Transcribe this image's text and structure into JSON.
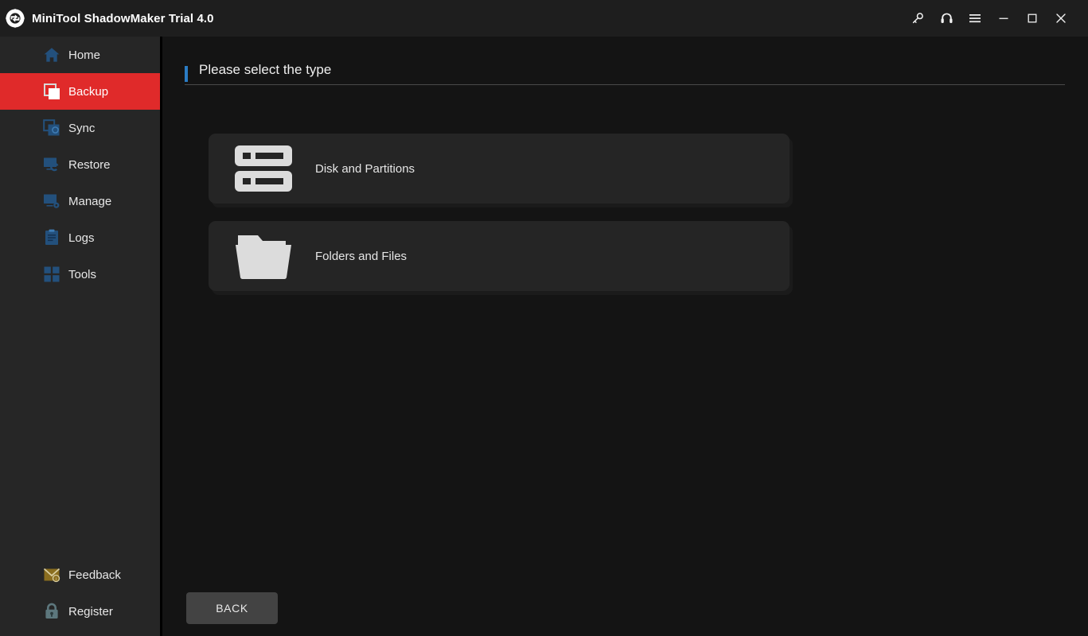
{
  "window": {
    "title": "MiniTool ShadowMaker Trial 4.0",
    "logo_icon": "minitool-circular-arrows-logo",
    "controls": [
      {
        "name": "key-icon",
        "label": "Key"
      },
      {
        "name": "headset-icon",
        "label": "Support"
      },
      {
        "name": "hamburger-menu-icon",
        "label": "Menu"
      },
      {
        "name": "minimize-icon",
        "label": "Minimize"
      },
      {
        "name": "maximize-icon",
        "label": "Maximize"
      },
      {
        "name": "close-icon",
        "label": "Close"
      }
    ]
  },
  "sidebar": {
    "items": [
      {
        "label": "Home",
        "icon": "home-icon",
        "active": false
      },
      {
        "label": "Backup",
        "icon": "backup-icon",
        "active": true
      },
      {
        "label": "Sync",
        "icon": "sync-icon",
        "active": false
      },
      {
        "label": "Restore",
        "icon": "restore-icon",
        "active": false
      },
      {
        "label": "Manage",
        "icon": "manage-icon",
        "active": false
      },
      {
        "label": "Logs",
        "icon": "logs-icon",
        "active": false
      },
      {
        "label": "Tools",
        "icon": "tools-icon",
        "active": false
      }
    ],
    "bottom_items": [
      {
        "label": "Feedback",
        "icon": "feedback-envelope-icon"
      },
      {
        "label": "Register",
        "icon": "register-lock-icon"
      }
    ]
  },
  "main": {
    "section_title": "Please select the type",
    "cards": [
      {
        "label": "Disk and Partitions",
        "icon": "disk-and-partitions-icon"
      },
      {
        "label": "Folders and Files",
        "icon": "folders-and-files-icon"
      }
    ],
    "back_label": "BACK"
  },
  "colors": {
    "accent_blue": "#2b7cc4",
    "active_red": "#e02a2a",
    "icon_blue": "#1f4a74",
    "sidebar_bg": "#262626",
    "main_bg": "#141414",
    "card_bg": "#252525",
    "titlebar_bg": "#1e1e1e",
    "feedback_gold": "#8a6d1f",
    "register_teal": "#4a6166"
  }
}
